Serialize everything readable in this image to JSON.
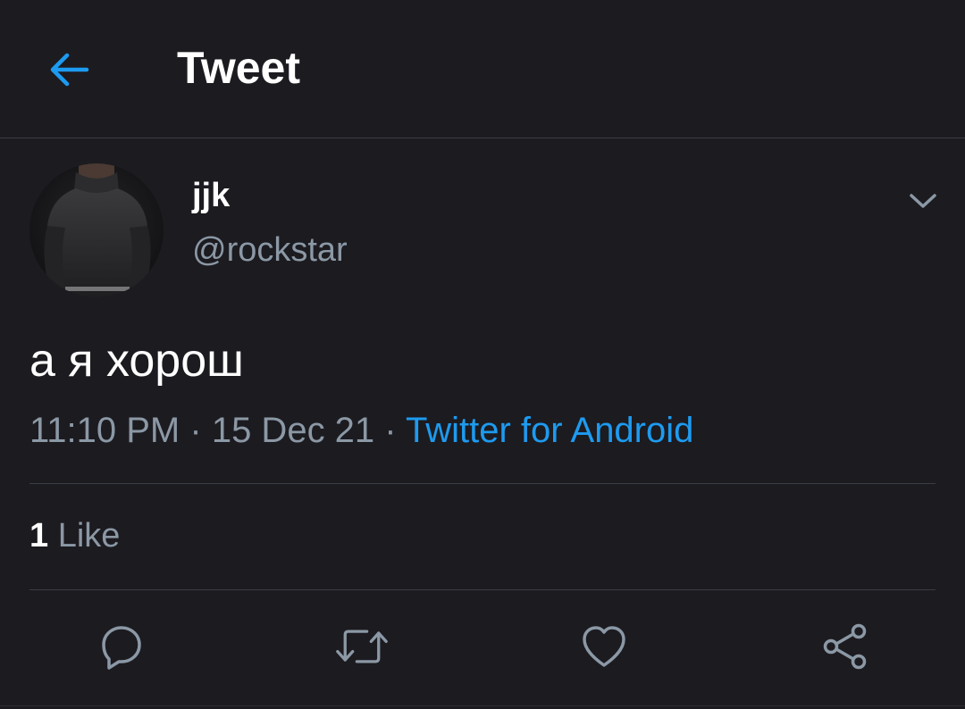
{
  "header": {
    "title": "Tweet",
    "back_icon": "arrow-left-icon"
  },
  "tweet": {
    "author": {
      "display_name": "jjk",
      "handle": "@rockstar"
    },
    "text": "а я хорош",
    "time": "11:10 PM",
    "separator": "·",
    "date": "15 Dec 21",
    "source": "Twitter for Android",
    "likes_count": "1",
    "likes_label": "Like"
  },
  "actions": [
    "reply-icon",
    "retweet-icon",
    "like-icon",
    "share-icon"
  ],
  "colors": {
    "background": "#1c1b20",
    "accent": "#1d9bf0",
    "secondary_text": "#8b98a5",
    "divider": "#3a3d44"
  }
}
